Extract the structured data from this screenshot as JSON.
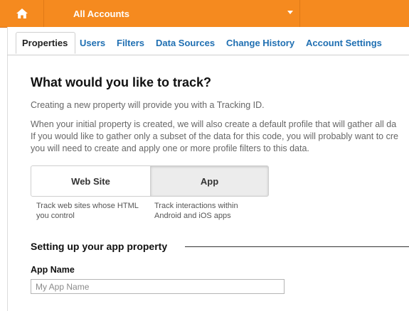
{
  "topbar": {
    "home_icon": "home-icon",
    "account_label": "All Accounts",
    "caret_icon": "chevron-down-icon",
    "brand_color": "#f58a1f"
  },
  "tabs": [
    {
      "label": "Properties",
      "active": true
    },
    {
      "label": "Users",
      "active": false
    },
    {
      "label": "Filters",
      "active": false
    },
    {
      "label": "Data Sources",
      "active": false
    },
    {
      "label": "Change History",
      "active": false
    },
    {
      "label": "Account Settings",
      "active": false
    }
  ],
  "main": {
    "heading": "What would you like to track?",
    "intro": "Creating a new property will provide you with a Tracking ID.",
    "details": [
      "When your initial property is created, we will also create a default profile that will gather all da",
      "If you would like to gather only a subset of the data for this code, you will probably want to cre",
      "you will need to create and apply one or more profile filters to this data."
    ],
    "options": {
      "web": {
        "label": "Web Site",
        "desc_line1": "Track web sites whose HTML",
        "desc_line2": "you control"
      },
      "app": {
        "label": "App",
        "selected": true,
        "desc_line1": "Track interactions within",
        "desc_line2": "Android and iOS apps"
      }
    },
    "section_title": "Setting up your app property",
    "app_name": {
      "label": "App Name",
      "placeholder": "My App Name",
      "value": ""
    }
  }
}
